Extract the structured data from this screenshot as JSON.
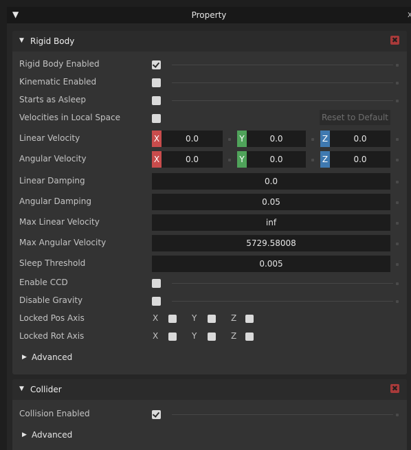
{
  "window": {
    "title": "Property",
    "collapse_icon": "triangle-down-icon",
    "close_icon": "close-icon"
  },
  "rigid_body": {
    "title": "Rigid Body",
    "remove_icon": "remove-component-icon",
    "rows": {
      "enabled": {
        "label": "Rigid Body Enabled",
        "checked": true
      },
      "kinematic": {
        "label": "Kinematic Enabled",
        "checked": false
      },
      "asleep": {
        "label": "Starts as Asleep",
        "checked": false
      },
      "local_space": {
        "label": "Velocities in Local Space",
        "checked": false
      }
    },
    "reset_label": "Reset to Default",
    "linear_velocity": {
      "label": "Linear Velocity",
      "x": "0.0",
      "y": "0.0",
      "z": "0.0"
    },
    "angular_velocity": {
      "label": "Angular Velocity",
      "x": "0.0",
      "y": "0.0",
      "z": "0.0"
    },
    "axis_labels": {
      "x": "X",
      "y": "Y",
      "z": "Z"
    },
    "linear_damping": {
      "label": "Linear Damping",
      "value": "0.0"
    },
    "angular_damping": {
      "label": "Angular Damping",
      "value": "0.05"
    },
    "max_linear_velocity": {
      "label": "Max Linear Velocity",
      "value": "inf"
    },
    "max_angular_velocity": {
      "label": "Max Angular Velocity",
      "value": "5729.58008"
    },
    "sleep_threshold": {
      "label": "Sleep Threshold",
      "value": "0.005"
    },
    "enable_ccd": {
      "label": "Enable CCD",
      "checked": false
    },
    "disable_gravity": {
      "label": "Disable Gravity",
      "checked": false
    },
    "locked_pos_axis": {
      "label": "Locked Pos Axis",
      "x": false,
      "y": false,
      "z": false
    },
    "locked_rot_axis": {
      "label": "Locked Rot Axis",
      "x": false,
      "y": false,
      "z": false
    },
    "advanced_label": "Advanced"
  },
  "collider": {
    "title": "Collider",
    "remove_icon": "remove-component-icon",
    "collision_enabled": {
      "label": "Collision Enabled",
      "checked": true
    },
    "advanced_label": "Advanced"
  },
  "colors": {
    "axis_x": "#c94c4c",
    "axis_y": "#4fa35a",
    "axis_z": "#3f79b0",
    "remove": "#a83a3a"
  }
}
